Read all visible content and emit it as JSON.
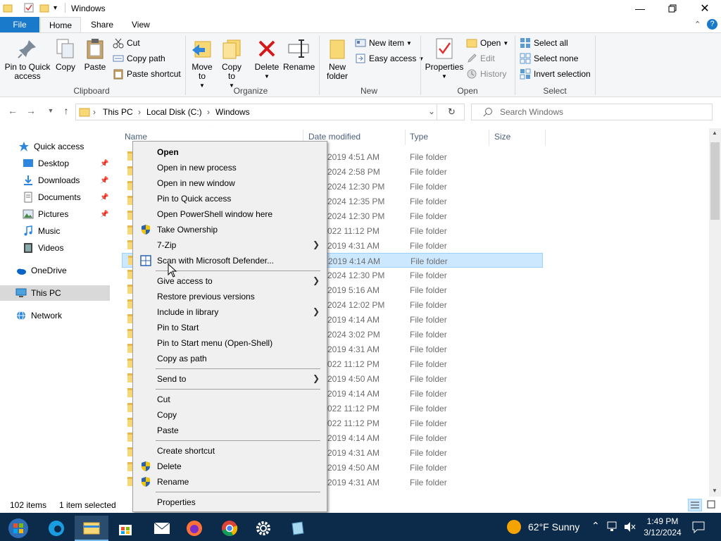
{
  "window": {
    "title": "Windows"
  },
  "ribbon": {
    "tabs": [
      "File",
      "Home",
      "Share",
      "View"
    ],
    "clipboard": {
      "pin": "Pin to Quick access",
      "copy": "Copy",
      "paste": "Paste",
      "cut": "Cut",
      "copy_path": "Copy path",
      "paste_shortcut": "Paste shortcut",
      "label": "Clipboard"
    },
    "organize": {
      "move_to": "Move to",
      "copy_to": "Copy to",
      "delete": "Delete",
      "rename": "Rename",
      "label": "Organize"
    },
    "new": {
      "new_folder": "New folder",
      "new_item": "New item",
      "easy_access": "Easy access",
      "label": "New"
    },
    "open": {
      "properties": "Properties",
      "open": "Open",
      "edit": "Edit",
      "history": "History",
      "label": "Open"
    },
    "select": {
      "select_all": "Select all",
      "select_none": "Select none",
      "invert": "Invert selection",
      "label": "Select"
    }
  },
  "address": {
    "crumbs": [
      "This PC",
      "Local Disk (C:)",
      "Windows"
    ],
    "search_placeholder": "Search Windows"
  },
  "sidebar": {
    "items": [
      {
        "label": "Quick access",
        "icon": "star-icon"
      },
      {
        "label": "Desktop",
        "icon": "desktop-icon",
        "pinned": true
      },
      {
        "label": "Downloads",
        "icon": "download-icon",
        "pinned": true
      },
      {
        "label": "Documents",
        "icon": "document-icon",
        "pinned": true
      },
      {
        "label": "Pictures",
        "icon": "picture-icon",
        "pinned": true
      },
      {
        "label": "Music",
        "icon": "music-icon"
      },
      {
        "label": "Videos",
        "icon": "video-icon"
      },
      {
        "label": "OneDrive",
        "icon": "cloud-icon"
      },
      {
        "label": "This PC",
        "icon": "computer-icon",
        "selected": true
      },
      {
        "label": "Network",
        "icon": "network-icon"
      }
    ]
  },
  "list": {
    "columns": [
      "Name",
      "Date modified",
      "Type",
      "Size"
    ],
    "rows": [
      {
        "date": "2019 4:51 AM",
        "type": "File folder"
      },
      {
        "date": "2024 2:58 PM",
        "type": "File folder"
      },
      {
        "date": "2024 12:30 PM",
        "type": "File folder"
      },
      {
        "date": "2024 12:35 PM",
        "type": "File folder"
      },
      {
        "date": "2024 12:30 PM",
        "type": "File folder"
      },
      {
        "date": "022 11:12 PM",
        "type": "File folder"
      },
      {
        "date": "2019 4:31 AM",
        "type": "File folder"
      },
      {
        "date": "2019 4:14 AM",
        "type": "File folder",
        "selected": true
      },
      {
        "date": "2024 12:30 PM",
        "type": "File folder"
      },
      {
        "date": "2019 5:16 AM",
        "type": "File folder"
      },
      {
        "date": "2024 12:02 PM",
        "type": "File folder"
      },
      {
        "date": "2019 4:14 AM",
        "type": "File folder"
      },
      {
        "date": "2024 3:02 PM",
        "type": "File folder"
      },
      {
        "date": "2019 4:31 AM",
        "type": "File folder"
      },
      {
        "date": "022 11:12 PM",
        "type": "File folder"
      },
      {
        "date": "2019 4:50 AM",
        "type": "File folder"
      },
      {
        "date": "2019 4:14 AM",
        "type": "File folder"
      },
      {
        "date": "022 11:12 PM",
        "type": "File folder"
      },
      {
        "date": "022 11:12 PM",
        "type": "File folder"
      },
      {
        "date": "2019 4:14 AM",
        "type": "File folder"
      },
      {
        "date": "2019 4:31 AM",
        "type": "File folder"
      },
      {
        "date": "2019 4:50 AM",
        "type": "File folder"
      },
      {
        "date": "2019 4:31 AM",
        "type": "File folder"
      }
    ]
  },
  "status": {
    "count": "102 items",
    "selected": "1 item selected"
  },
  "context_menu": {
    "items": [
      {
        "label": "Open",
        "bold": true
      },
      {
        "label": "Open in new process"
      },
      {
        "label": "Open in new window"
      },
      {
        "label": "Pin to Quick access"
      },
      {
        "label": "Open PowerShell window here"
      },
      {
        "label": "Take Ownership",
        "icon": "shield-icon"
      },
      {
        "label": "7-Zip",
        "submenu": true
      },
      {
        "label": "Scan with Microsoft Defender...",
        "icon": "defender-icon"
      },
      {
        "sep": true
      },
      {
        "label": "Give access to",
        "submenu": true
      },
      {
        "label": "Restore previous versions"
      },
      {
        "label": "Include in library",
        "submenu": true
      },
      {
        "label": "Pin to Start"
      },
      {
        "label": "Pin to Start menu (Open-Shell)"
      },
      {
        "label": "Copy as path"
      },
      {
        "sep": true
      },
      {
        "label": "Send to",
        "submenu": true
      },
      {
        "sep": true
      },
      {
        "label": "Cut"
      },
      {
        "label": "Copy"
      },
      {
        "label": "Paste"
      },
      {
        "sep": true
      },
      {
        "label": "Create shortcut"
      },
      {
        "label": "Delete",
        "icon": "shield-icon"
      },
      {
        "label": "Rename",
        "icon": "shield-icon"
      },
      {
        "sep": true
      },
      {
        "label": "Properties"
      }
    ]
  },
  "taskbar": {
    "weather": "62°F  Sunny",
    "time": "1:49 PM",
    "date": "3/12/2024"
  },
  "colors": {
    "accent": "#1979ca",
    "selection": "#cce8ff",
    "taskbar": "#0c2a4a"
  }
}
